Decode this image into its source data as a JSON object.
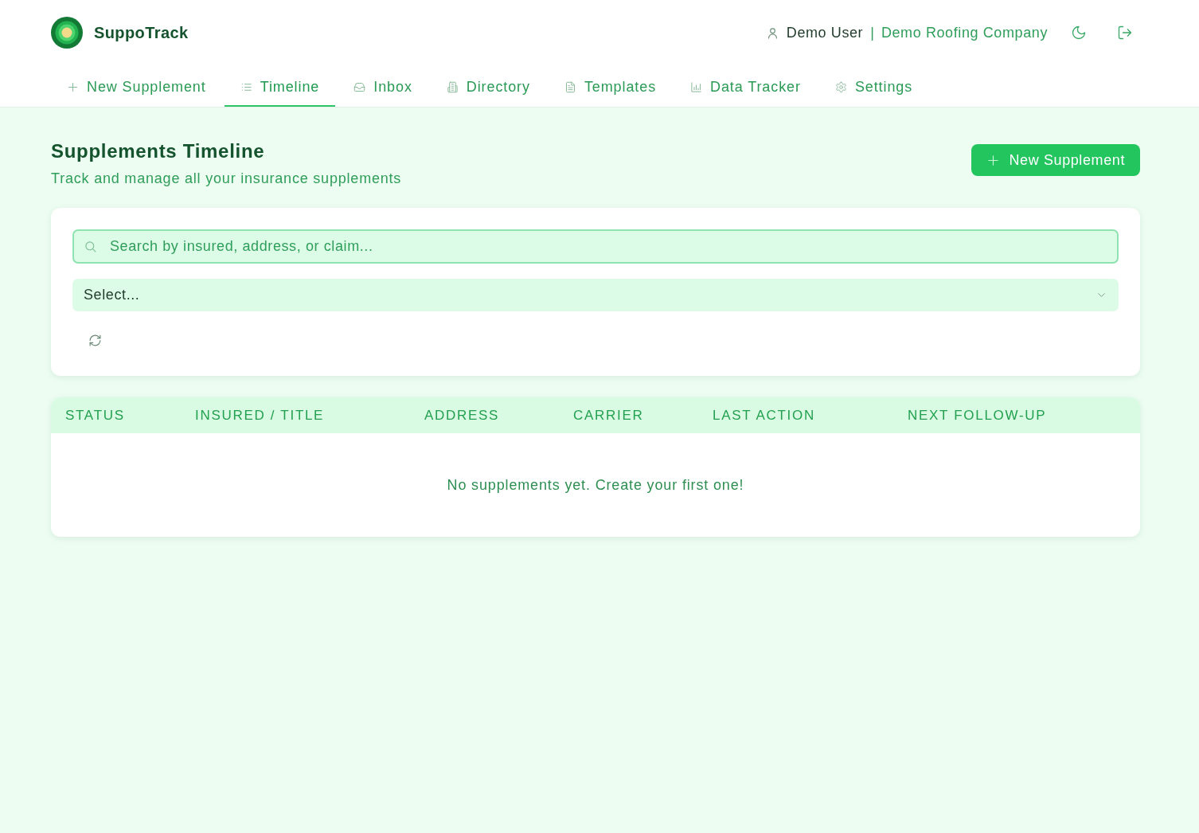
{
  "header": {
    "brand": "SuppoTrack",
    "user": "Demo User",
    "separator": "|",
    "company": "Demo Roofing Company"
  },
  "nav": {
    "tabs": [
      {
        "label": "New Supplement",
        "selected": false
      },
      {
        "label": "Timeline",
        "selected": true
      },
      {
        "label": "Inbox",
        "selected": false
      },
      {
        "label": "Directory",
        "selected": false
      },
      {
        "label": "Templates",
        "selected": false
      },
      {
        "label": "Data Tracker",
        "selected": false
      },
      {
        "label": "Settings",
        "selected": false
      }
    ]
  },
  "page": {
    "title": "Supplements Timeline",
    "subtitle": "Track and manage all your insurance supplements",
    "new_button": "New Supplement"
  },
  "filters": {
    "search": {
      "placeholder": "Search by insured, address, or claim..."
    },
    "select": {
      "placeholder": "Select..."
    }
  },
  "table": {
    "columns": [
      "STATUS",
      "INSURED / TITLE",
      "ADDRESS",
      "CARRIER",
      "LAST ACTION",
      "NEXT FOLLOW-UP"
    ],
    "empty_message": "No supplements yet. Create your first one!"
  }
}
